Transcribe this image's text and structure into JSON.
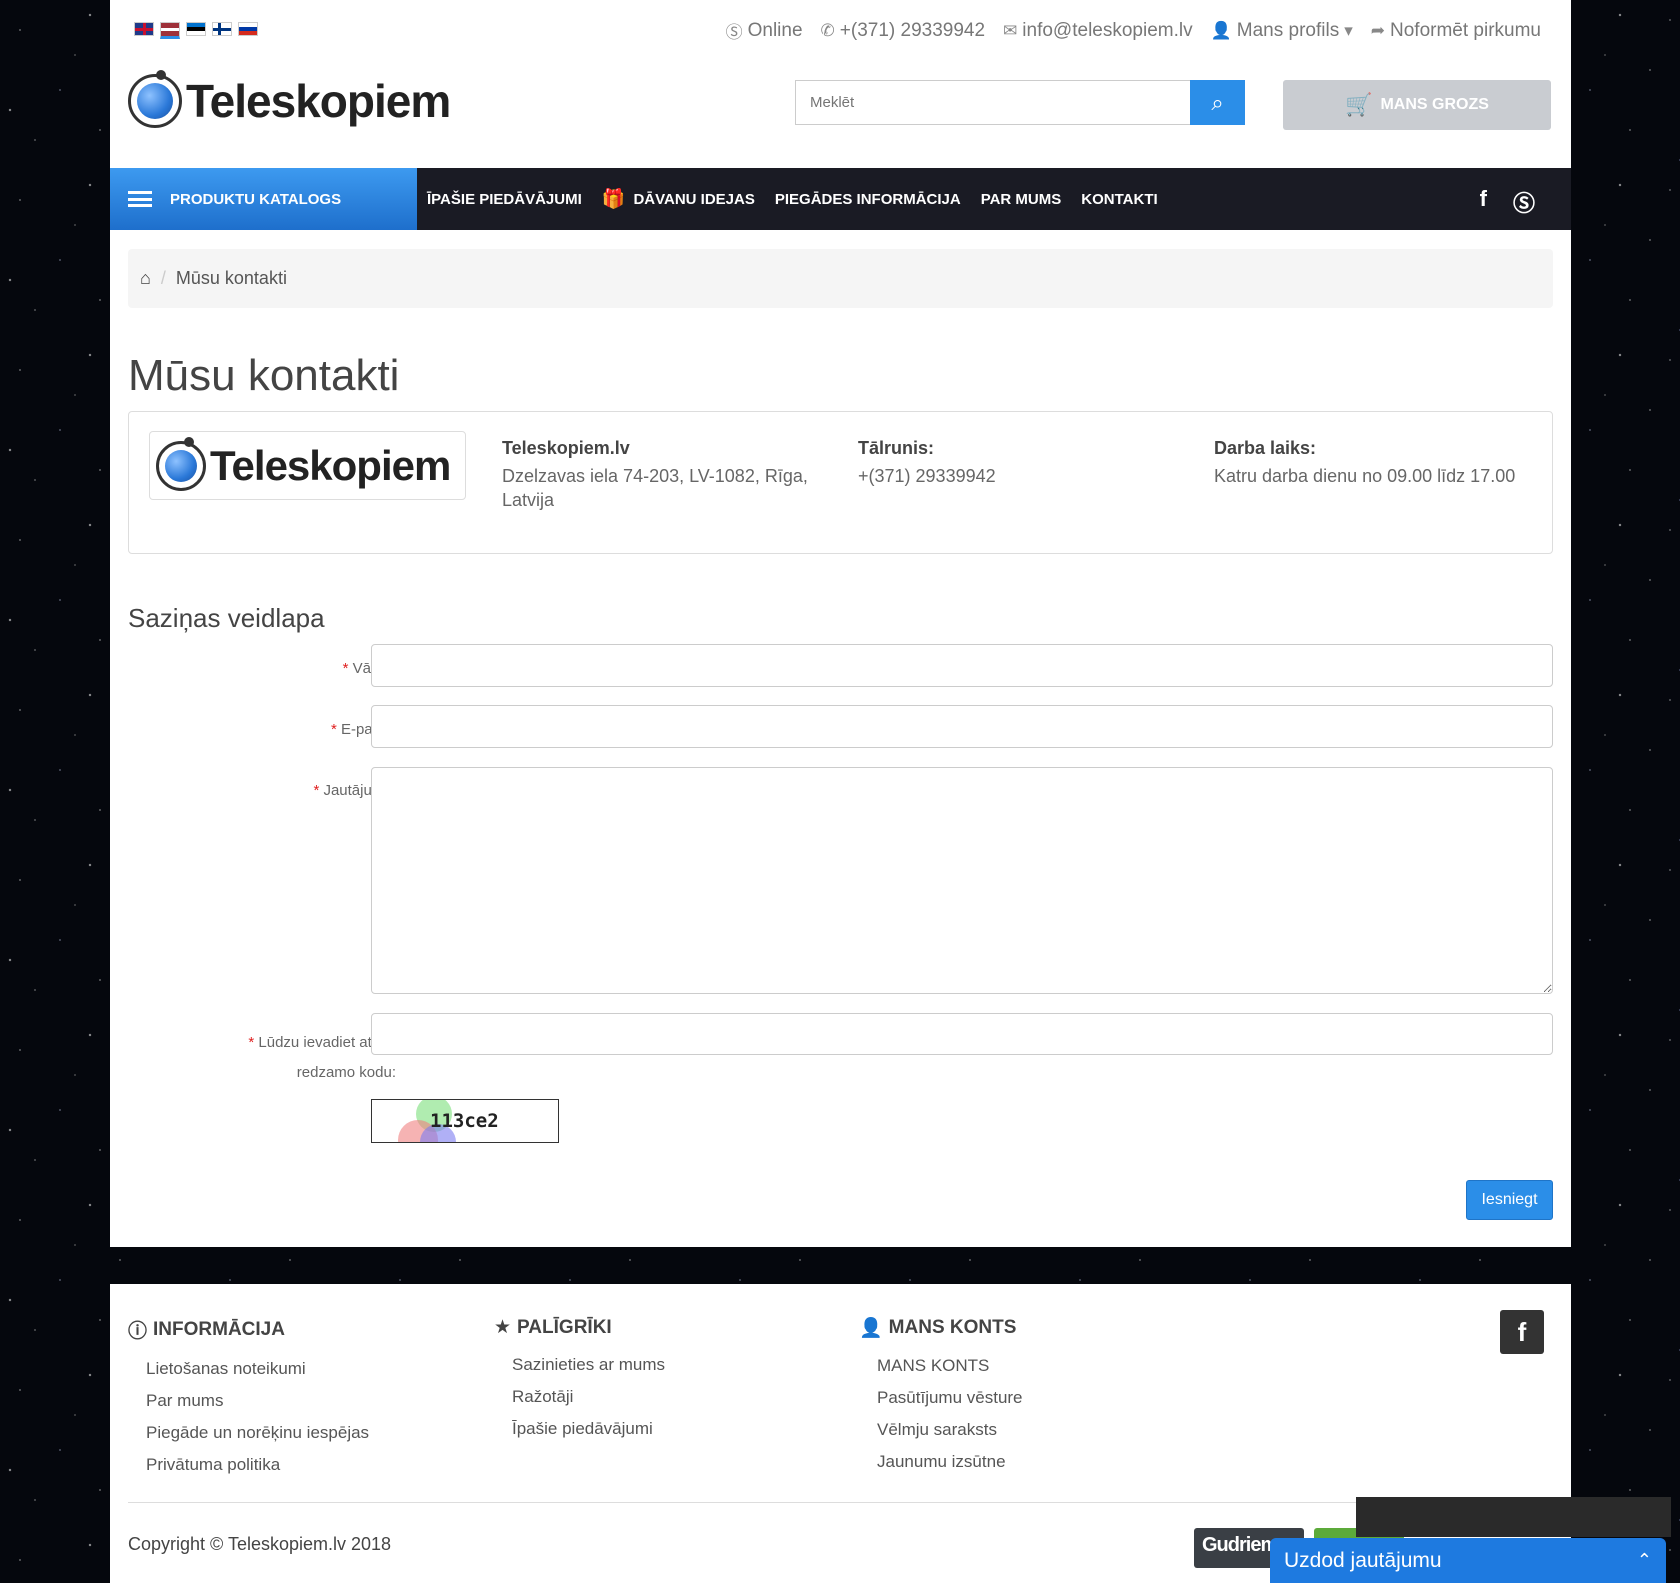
{
  "topbar": {
    "flags": [
      "gb-flag-icon",
      "lv-flag-icon",
      "ee-flag-icon",
      "fi-flag-icon",
      "ru-flag-icon"
    ],
    "online": "Online",
    "phone": "+(371) 29339942",
    "email": "info@teleskopiem.lv",
    "profile": "Mans profils",
    "checkout": "Noformēt pirkumu"
  },
  "header": {
    "logo_text": "Teleskopiem",
    "search_placeholder": "Meklēt",
    "cart_label": "MANS GROZS"
  },
  "nav": {
    "catalog": "PRODUKTU KATALOGS",
    "items": [
      "ĪPAŠIE PIEDĀVĀJUMI",
      "DĀVANU IDEJAS",
      "PIEGĀDES INFORMĀCIJA",
      "PAR MUMS",
      "KONTAKTI"
    ]
  },
  "breadcrumb": {
    "current": "Mūsu kontakti"
  },
  "page": {
    "title": "Mūsu kontakti"
  },
  "contact": {
    "logo_text": "Teleskopiem",
    "company": "Teleskopiem.lv",
    "address_line1": "Dzelzavas iela 74-203, LV-1082, Rīga,",
    "address_line2": "Latvija",
    "phone_label": "Tālrunis:",
    "phone": "+(371) 29339942",
    "hours_label": "Darba laiks:",
    "hours": "Katru darba dienu no 09.00 līdz 17.00"
  },
  "form": {
    "legend": "Saziņas veidlapa",
    "name_label": "Vārds:",
    "email_label": "E-pasts:",
    "question_label": "Jautājums:",
    "captcha_label_line1": "Lūdzu ievadiet attēlā",
    "captcha_label_line2": "redzamo kodu:",
    "captcha_code": "113ce2",
    "submit": "Iesniegt"
  },
  "footer": {
    "info_title": "INFORMĀCIJA",
    "info_links": [
      "Lietošanas noteikumi",
      "Par mums",
      "Piegāde un norēķinu iespējas",
      "Privātuma politika"
    ],
    "tools_title": "PALĪGRĪKI",
    "tools_links": [
      "Sazinieties ar mums",
      "Ražotāji",
      "Īpašie piedāvājumi"
    ],
    "account_title": "MANS KONTS",
    "account_links": [
      "MANS KONTS",
      "Pasūtījumu vēsture",
      "Vēlmju saraksts",
      "Jaunumu izsūtne"
    ],
    "copyright": "Copyright © Teleskopiem.lv 2018",
    "badge_text": "Gudriem"
  },
  "chat": {
    "label": "Uzdod jautājumu"
  }
}
